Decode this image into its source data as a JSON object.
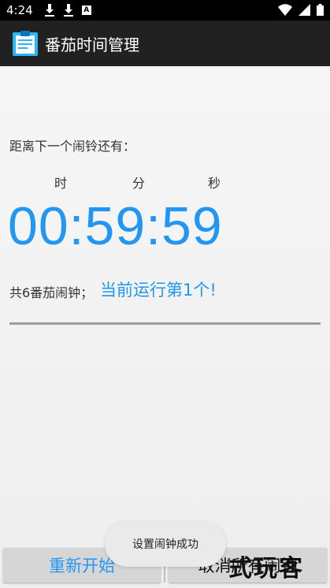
{
  "status_bar": {
    "time": "4:24",
    "a_icon_text": "A"
  },
  "app_bar": {
    "title": "番茄时间管理"
  },
  "countdown": {
    "label": "距离下一个闹铃还有：",
    "unit_hours": "时",
    "unit_minutes": "分",
    "unit_seconds": "秒",
    "time": "00:59:59"
  },
  "alarm_info": {
    "total": "共6番茄闹钟；",
    "current": "当前运行第1个!"
  },
  "buttons": {
    "restart": "重新开始",
    "cancel_all": "取消所有闹钟"
  },
  "toast": {
    "message": "设置闹钟成功"
  },
  "watermark": {
    "text": "式玩客"
  },
  "colors": {
    "accent": "#2196f3",
    "app_bar": "#212121",
    "status_bar": "#000000"
  }
}
